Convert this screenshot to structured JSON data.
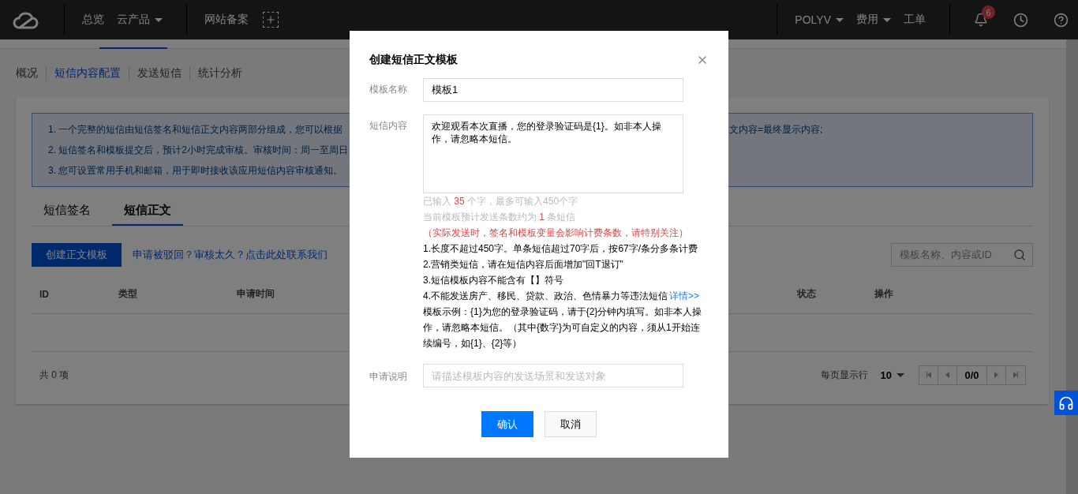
{
  "nav": {
    "left_items": [
      {
        "label": "总览",
        "dropdown": false
      },
      {
        "label": "云产品",
        "dropdown": true
      },
      {
        "label": "网站备案",
        "dropdown": false
      }
    ],
    "right_items": [
      {
        "label": "POLYV",
        "dropdown": true
      },
      {
        "label": "费用",
        "dropdown": true
      },
      {
        "label": "工单",
        "dropdown": false
      }
    ],
    "notification_count": "6"
  },
  "sub_nav": [
    {
      "label": "概况",
      "selected": false
    },
    {
      "label": "短信内容配置",
      "selected": true
    },
    {
      "label": "发送短信",
      "selected": false
    },
    {
      "label": "统计分析",
      "selected": false
    }
  ],
  "notice": {
    "lines": [
      {
        "left": "1. 一个完整的短信由短信签名和短信正文内容两部分组成，您可以根据",
        "right": "文内容=最终显示内容;"
      },
      {
        "left": "2. 短信签名和模板提交后，预计2小时完成审核。审核时间：周一至周日"
      },
      {
        "left": "3. 您可设置常用手机和邮箱，用于即时接收该应用短信内容审核通知。"
      }
    ]
  },
  "tabs": [
    {
      "label": "短信签名",
      "selected": false
    },
    {
      "label": "短信正文",
      "selected": true
    }
  ],
  "create_button": "创建正文模板",
  "help_link": "申请被驳回？审核太久？点击此处联系我们",
  "search": {
    "placeholder": "模板名称、内容或ID"
  },
  "table": {
    "columns": [
      "ID",
      "类型",
      "申请时间",
      "状态",
      "操作"
    ]
  },
  "footer": {
    "total": "共 0 项",
    "page_size_label": "每页显示行",
    "page_size": "10",
    "page": "0/0"
  },
  "dialog": {
    "title": "创建短信正文模板",
    "name": {
      "label": "模板名称",
      "value": "模板1"
    },
    "content": {
      "label": "短信内容",
      "value": "欢迎观看本次直播，您的登录验证码是{1}。如非本人操作，请忽略本短信。"
    },
    "counter": {
      "before": "已输入 ",
      "count": "35",
      "after": " 个字，最多可输入450个字"
    },
    "estimate": {
      "before": "当前模板预计发送条数约为 ",
      "count": "1",
      "after": " 条短信"
    },
    "warning": "（实际发送时，签名和模板变量会影响计费条数，请特别关注）",
    "rules": [
      {
        "text": "1.长度不超过450字。单条短信超过70字后，按67字/条分多条计费"
      },
      {
        "text": "2.营销类短信，请在短信内容后面增加\"回T退订\""
      },
      {
        "text": "3.短信模板内容不能含有【】符号"
      },
      {
        "text": "4.不能发送房产、移民、贷款、政治、色情暴力等违法短信",
        "link": "详情>>"
      }
    ],
    "example": "模板示例：{1}为您的登录验证码，请于{2}分钟内填写。如非本人操作，请忽略本短信。（其中{数字}为可自定义的内容，须从1开始连续编号，如{1}、{2}等）",
    "remark": {
      "label": "申请说明",
      "placeholder": "请描述模板内容的发送场景和发送对象"
    },
    "buttons": [
      {
        "label": "确认",
        "kind": "primary"
      },
      {
        "label": "取消",
        "kind": "default"
      }
    ]
  }
}
